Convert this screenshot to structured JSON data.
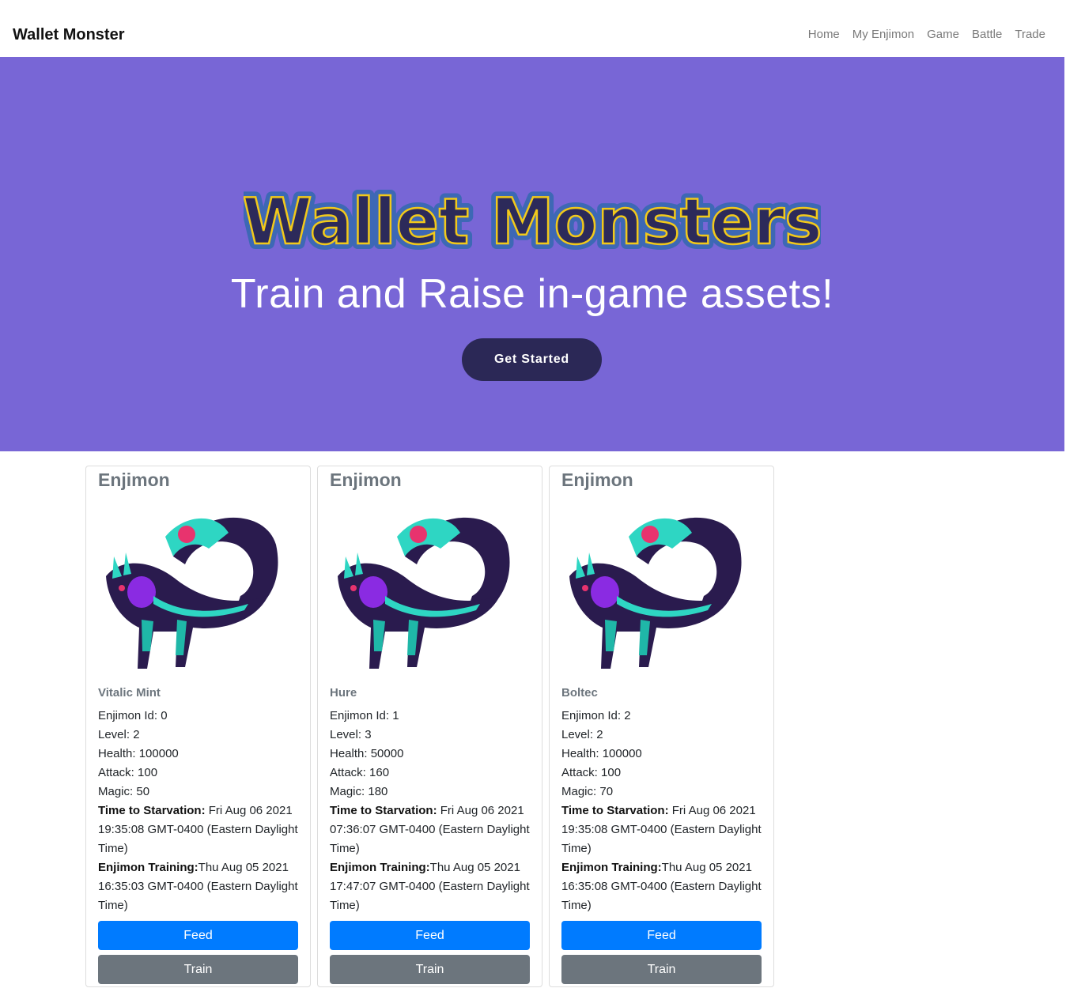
{
  "navbar": {
    "brand": "Wallet Monster",
    "links": [
      "Home",
      "My Enjimon",
      "Game",
      "Battle",
      "Trade"
    ]
  },
  "hero": {
    "logo_text": "Wallet Monsters",
    "tagline": "Train and Raise in-game assets!",
    "cta_label": "Get Started",
    "background": "#7866d6",
    "cta_color": "#2b2856"
  },
  "cards": [
    {
      "title": "Enjimon",
      "name": "Vitalic Mint",
      "id_label": "Enjimon Id:",
      "id": "0",
      "level_label": "Level:",
      "level": "2",
      "health_label": "Health:",
      "health": "100000",
      "attack_label": "Attack:",
      "attack": "100",
      "magic_label": "Magic:",
      "magic": "50",
      "starvation_label": "Time to Starvation:",
      "starvation": "Fri Aug 06 2021 19:35:08 GMT-0400 (Eastern Daylight Time)",
      "training_label": "Enjimon Training:",
      "training": "Thu Aug 05 2021 16:35:03 GMT-0400 (Eastern Daylight Time)",
      "feed_label": "Feed",
      "train_label": "Train"
    },
    {
      "title": "Enjimon",
      "name": "Hure",
      "id_label": "Enjimon Id:",
      "id": "1",
      "level_label": "Level:",
      "level": "3",
      "health_label": "Health:",
      "health": "50000",
      "attack_label": "Attack:",
      "attack": "160",
      "magic_label": "Magic:",
      "magic": "180",
      "starvation_label": "Time to Starvation:",
      "starvation": "Fri Aug 06 2021 07:36:07 GMT-0400 (Eastern Daylight Time)",
      "training_label": "Enjimon Training:",
      "training": "Thu Aug 05 2021 17:47:07 GMT-0400 (Eastern Daylight Time)",
      "feed_label": "Feed",
      "train_label": "Train"
    },
    {
      "title": "Enjimon",
      "name": "Boltec",
      "id_label": "Enjimon Id:",
      "id": "2",
      "level_label": "Level:",
      "level": "2",
      "health_label": "Health:",
      "health": "100000",
      "attack_label": "Attack:",
      "attack": "100",
      "magic_label": "Magic:",
      "magic": "70",
      "starvation_label": "Time to Starvation:",
      "starvation": "Fri Aug 06 2021 19:35:08 GMT-0400 (Eastern Daylight Time)",
      "training_label": "Enjimon Training:",
      "training": "Thu Aug 05 2021 16:35:08 GMT-0400 (Eastern Daylight Time)",
      "feed_label": "Feed",
      "train_label": "Train"
    }
  ]
}
